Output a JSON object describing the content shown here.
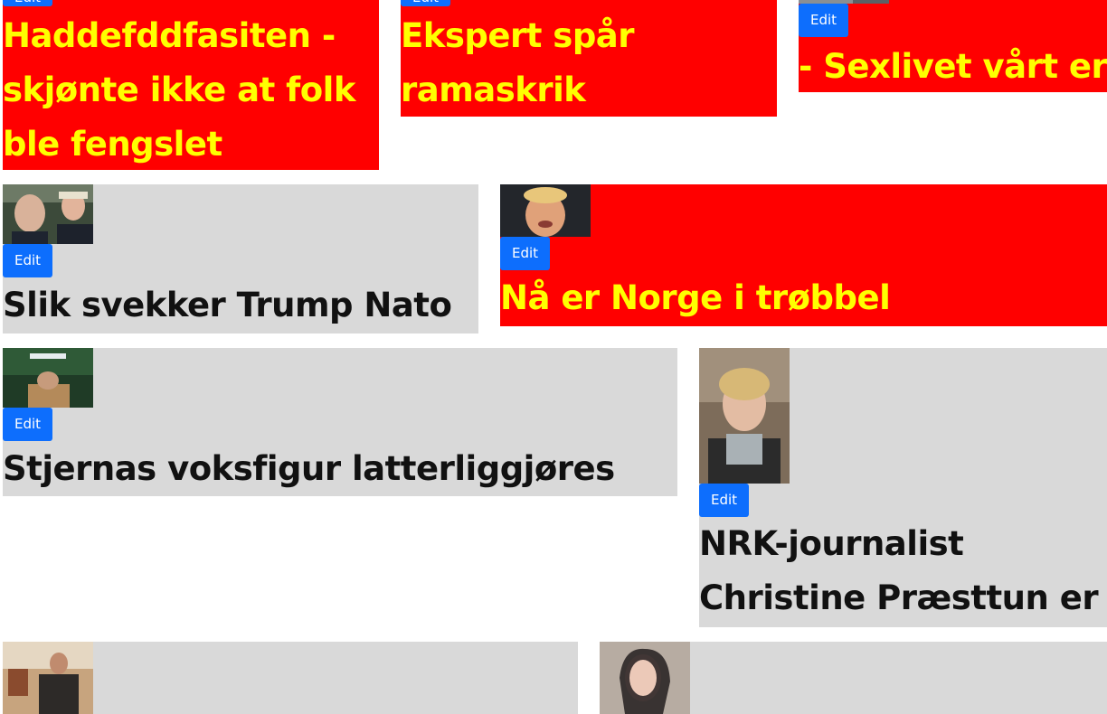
{
  "edit_label": "Edit",
  "colors": {
    "breaking_bg": "#ff0000",
    "breaking_text": "#ffff00",
    "normal_bg": "#d9d9d9",
    "normal_text": "#111111",
    "edit_button": "#0d6efd"
  },
  "articles": [
    {
      "title": "Haddefddfasiten - skjønte ikke at folk ble fengslet",
      "style": "breaking"
    },
    {
      "title": "Ekspert spår ramaskrik",
      "style": "breaking"
    },
    {
      "title": "- Sexlivet vårt er o",
      "style": "breaking"
    },
    {
      "title": "Slik svekker Trump Nato",
      "style": "normal"
    },
    {
      "title": "Nå er Norge i trøbbel",
      "style": "breaking"
    },
    {
      "title": "Stjernas voksfigur latterliggjøres",
      "style": "normal"
    },
    {
      "title": "NRK-journalist Christine Præsttun er død",
      "style": "normal"
    },
    {
      "title": "",
      "style": "normal"
    },
    {
      "title": "",
      "style": "normal"
    }
  ]
}
